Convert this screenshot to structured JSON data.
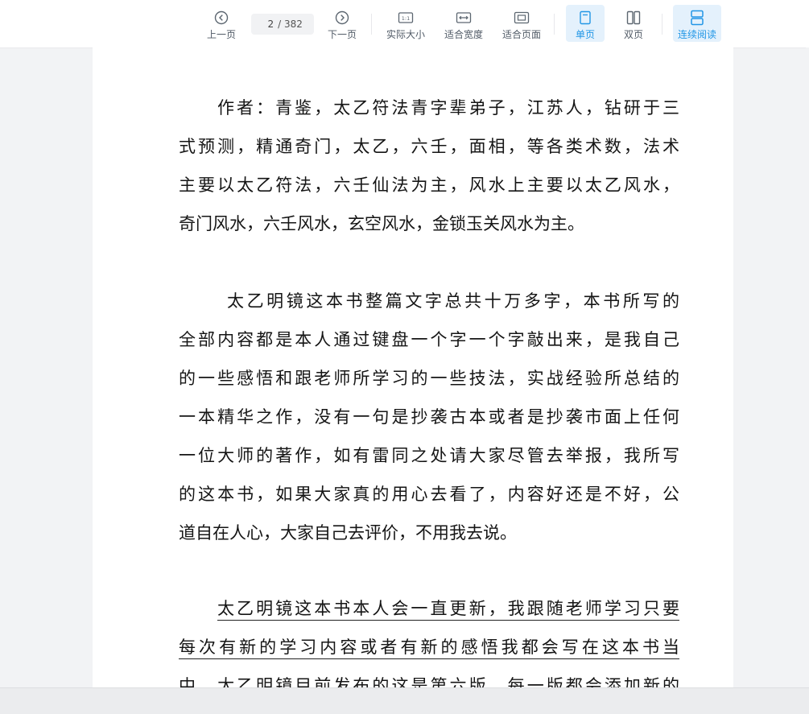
{
  "toolbar": {
    "prev_label": "上一页",
    "next_label": "下一页",
    "current_page": "2",
    "page_total": "/ 382",
    "actual_size_label": "实际大小",
    "fit_width_label": "适合宽度",
    "fit_page_label": "适合页面",
    "single_page_label": "单页",
    "double_page_label": "双页",
    "continuous_label": "连续阅读",
    "accent_color": "#2196e6"
  },
  "document": {
    "paragraph1": [
      "作者：青鉴，太乙符法青字辈弟子，江苏人，钻研于三",
      "式预测，精通奇门，太乙，六壬，面相，等各类术数，法术",
      "主要以太乙符法，六壬仙法为主，风水上主要以太乙风水，",
      "奇门风水，六壬风水，玄空风水，金锁玉关风水为主。"
    ],
    "paragraph2": [
      "太乙明镜这本书整篇文字总共十万多字，本书所写的",
      "全部内容都是本人通过键盘一个字一个字敲出来，是我自己",
      "的一些感悟和跟老师所学习的一些技法，实战经验所总结的",
      "一本精华之作，没有一句是抄袭古本或者是抄袭市面上任何",
      "一位大师的著作，如有雷同之处请大家尽管去举报，我所写",
      "的这本书，如果大家真的用心去看了，内容好还是不好，公",
      "道自在人心，大家自己去评价，不用我去说。"
    ],
    "paragraph3": [
      "太乙明镜这本书本人会一直更新，我跟随老师学习只要",
      "每次有新的学习内容或者有新的感悟我都会写在这本书当",
      "中，太乙明镜目前发布的这是第六版，每一版都会添加新的"
    ]
  }
}
